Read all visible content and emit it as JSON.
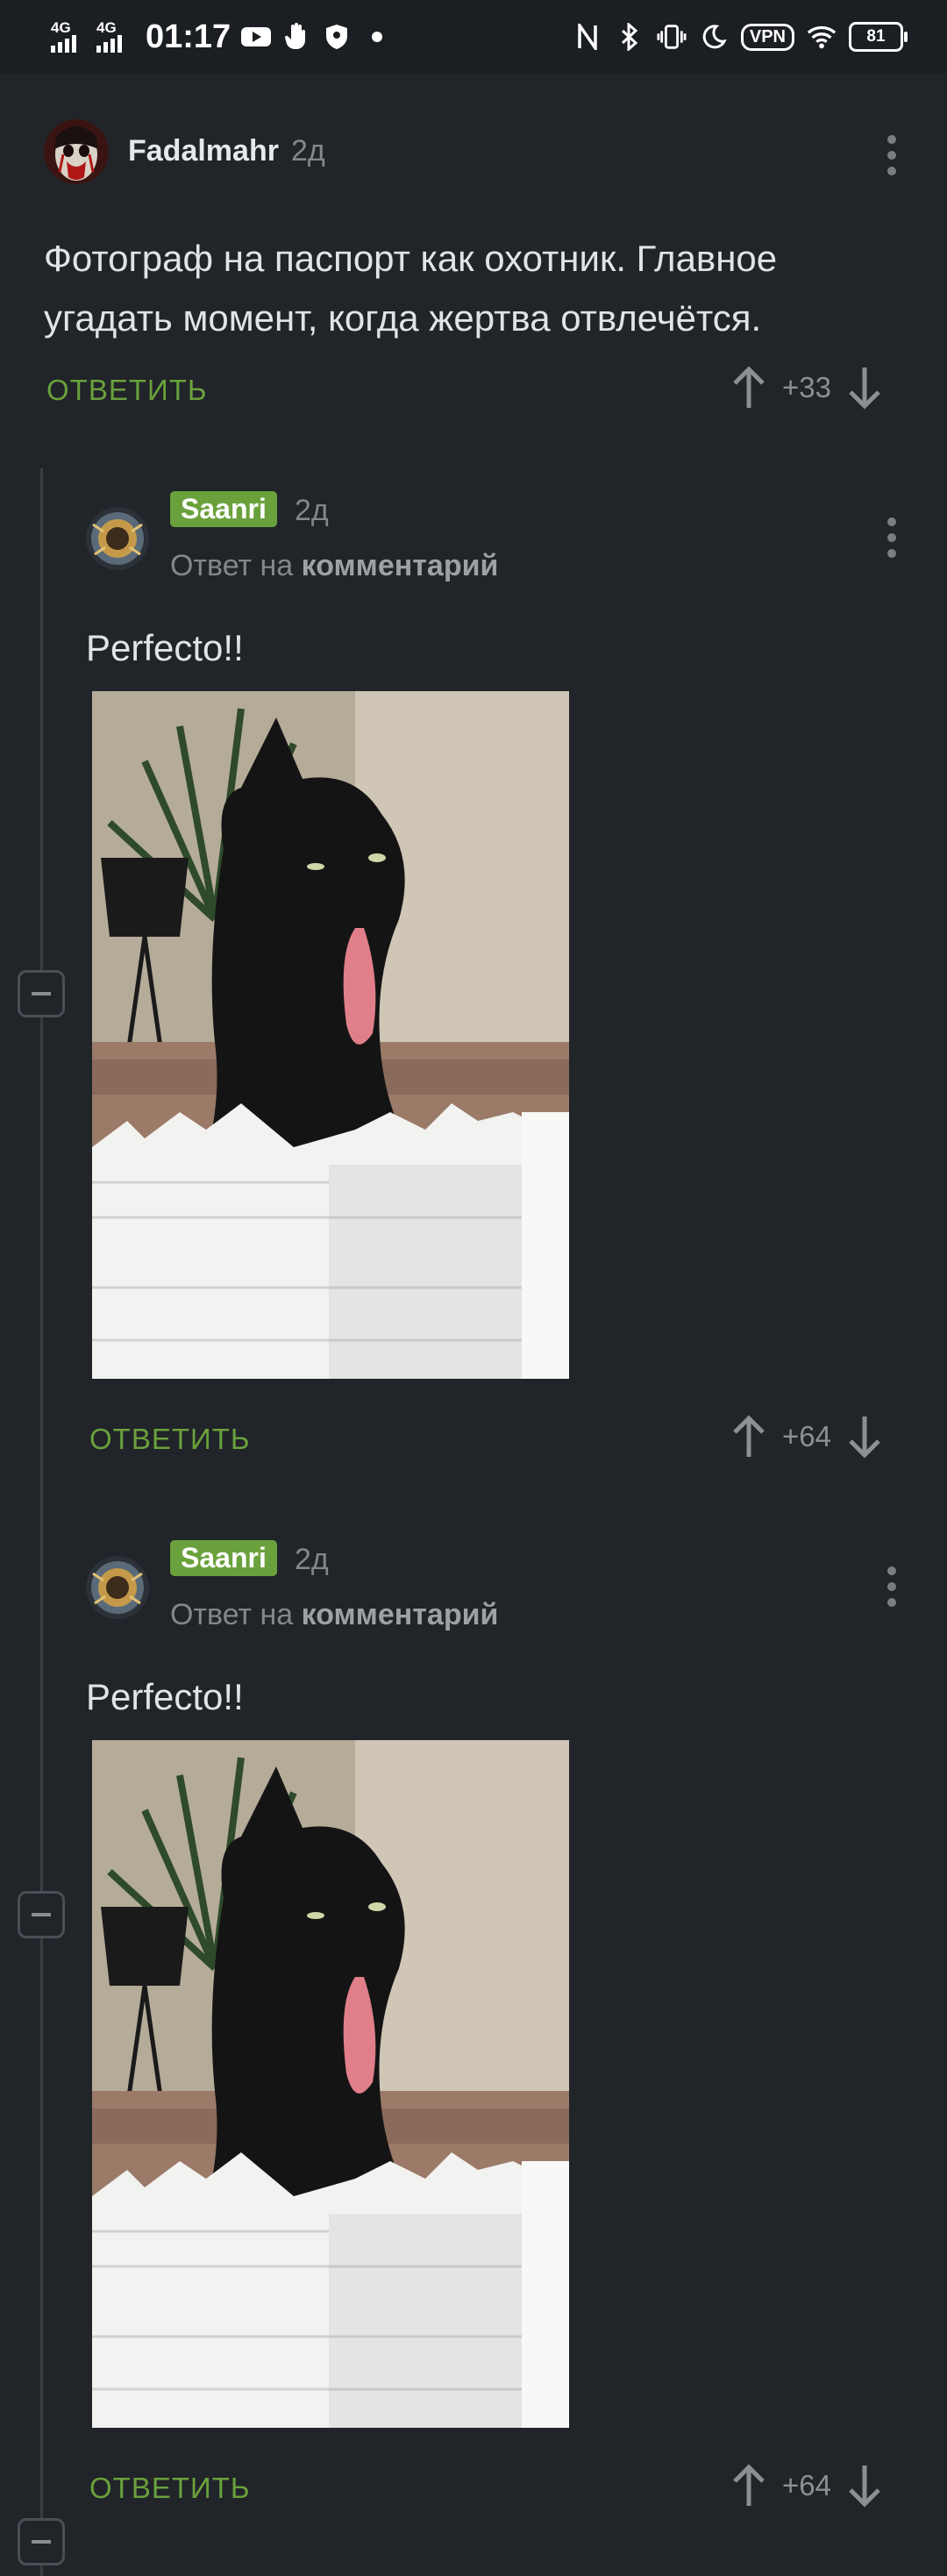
{
  "status_bar": {
    "network1": "4G",
    "network2": "4G",
    "time": "01:17",
    "vpn": "VPN",
    "battery": "81"
  },
  "comments": [
    {
      "username": "Fadalmahr",
      "time": "2д",
      "text": "Фотограф на паспорт как охотник. Главное угадать момент, когда жертва отвлечётся.",
      "reply_label": "ОТВЕТИТЬ",
      "score": "+33"
    },
    {
      "username": "Saanri",
      "time": "2д",
      "reply_to_prefix": "Ответ на",
      "reply_to_target": "комментарий",
      "text": "Perfecto!!",
      "reply_label": "ОТВЕТИТЬ",
      "score": "+64"
    },
    {
      "username": "Saanri",
      "time": "2д",
      "reply_to_prefix": "Ответ на",
      "reply_to_target": "комментарий",
      "text": "Perfecto!!",
      "reply_label": "ОТВЕТИТЬ",
      "score": "+64"
    }
  ],
  "colors": {
    "background": "#212429",
    "accent": "#6aa13c",
    "muted": "#83878b"
  }
}
